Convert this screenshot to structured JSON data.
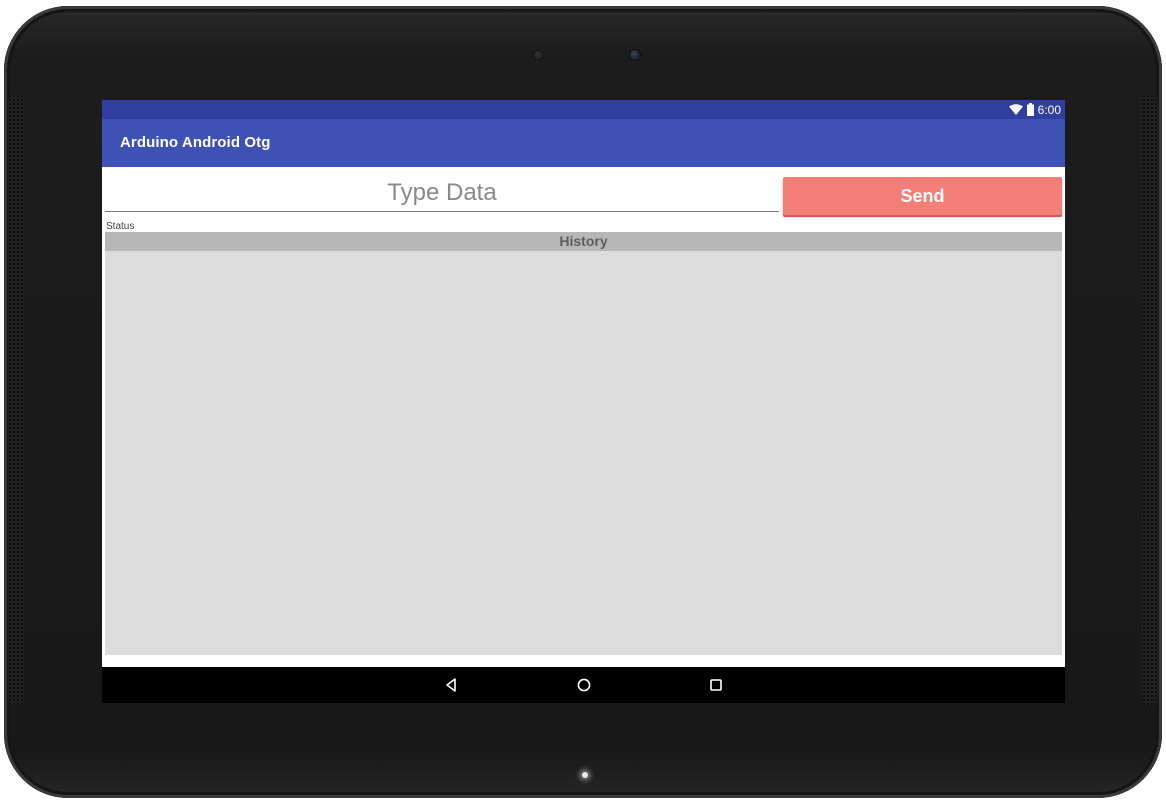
{
  "status_bar": {
    "time": "6:00",
    "wifi_icon": "wifi-icon",
    "battery_icon": "battery-icon",
    "background_color": "#303f9f"
  },
  "app_bar": {
    "title": "Arduino Android Otg",
    "background_color": "#3f51b5"
  },
  "input": {
    "placeholder": "Type Data",
    "value": ""
  },
  "send_button": {
    "label": "Send",
    "color": "#f47e78"
  },
  "status": {
    "label": "Status"
  },
  "history": {
    "header": "History",
    "items": []
  },
  "nav_bar": {
    "back_icon": "back-icon",
    "home_icon": "home-icon",
    "recents_icon": "recents-icon"
  }
}
